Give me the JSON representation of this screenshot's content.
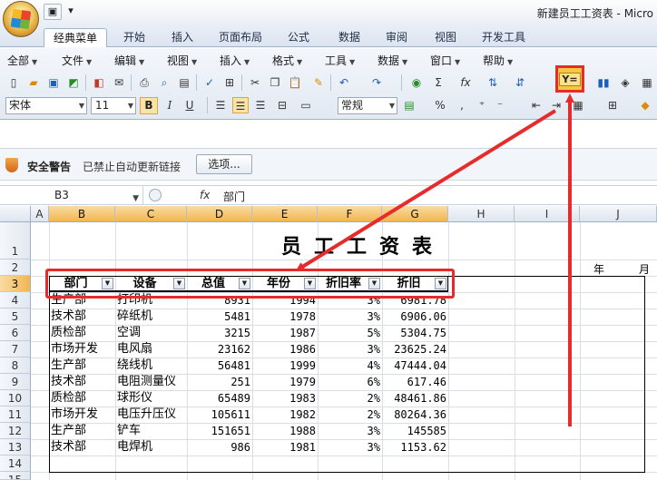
{
  "window": {
    "title": "新建员工工资表 - Micro"
  },
  "tabs": [
    "经典菜单",
    "开始",
    "插入",
    "页面布局",
    "公式",
    "数据",
    "审阅",
    "视图",
    "开发工具"
  ],
  "menus": [
    "全部",
    "文件",
    "编辑",
    "视图",
    "插入",
    "格式",
    "工具",
    "数据",
    "窗口",
    "帮助"
  ],
  "toolbar": {
    "font": "宋体",
    "size": "11",
    "bold": "B",
    "italic": "I",
    "underline": "U",
    "number_format": "常规",
    "filter_label": "Y=",
    "sigma": "Σ",
    "fx": "fx",
    "percent": "%",
    "comma": ","
  },
  "security": {
    "title": "安全警告",
    "message": "已禁止自动更新链接",
    "options": "选项..."
  },
  "formula_bar": {
    "cell_ref": "B3",
    "fx": "fx",
    "content": "部门"
  },
  "columns": [
    "A",
    "B",
    "C",
    "D",
    "E",
    "F",
    "G",
    "H",
    "I",
    "J"
  ],
  "rows": [
    "1",
    "2",
    "3",
    "4",
    "5",
    "6",
    "7",
    "8",
    "9",
    "10",
    "11",
    "12",
    "13",
    "14",
    "15"
  ],
  "sheet": {
    "title": "员工工资表",
    "year_label": "年",
    "month_label": "月",
    "headers": [
      "部门",
      "设备",
      "总值",
      "年份",
      "折旧率",
      "折旧"
    ],
    "records": [
      [
        "生产部",
        "打印机",
        "8931",
        "1994",
        "3%",
        "6981.78"
      ],
      [
        "技术部",
        "碎纸机",
        "5481",
        "1978",
        "3%",
        "6906.06"
      ],
      [
        "质检部",
        "空调",
        "3215",
        "1987",
        "5%",
        "5304.75"
      ],
      [
        "市场开发",
        "电风扇",
        "23162",
        "1986",
        "3%",
        "23625.24"
      ],
      [
        "生产部",
        "绕线机",
        "56481",
        "1999",
        "4%",
        "47444.04"
      ],
      [
        "技术部",
        "电阻测量仪",
        "251",
        "1979",
        "6%",
        "617.46"
      ],
      [
        "质检部",
        "球形仪",
        "65489",
        "1983",
        "2%",
        "48461.86"
      ],
      [
        "市场开发",
        "电压升压仪",
        "105611",
        "1982",
        "2%",
        "80264.36"
      ],
      [
        "生产部",
        "铲车",
        "151651",
        "1988",
        "3%",
        "145585"
      ],
      [
        "技术部",
        "电焊机",
        "986",
        "1981",
        "3%",
        "1153.62"
      ]
    ]
  },
  "colors": {
    "annotation": "#e62b2b",
    "selected_header": "#f2b64f",
    "ribbon": "#e2e9f3"
  }
}
